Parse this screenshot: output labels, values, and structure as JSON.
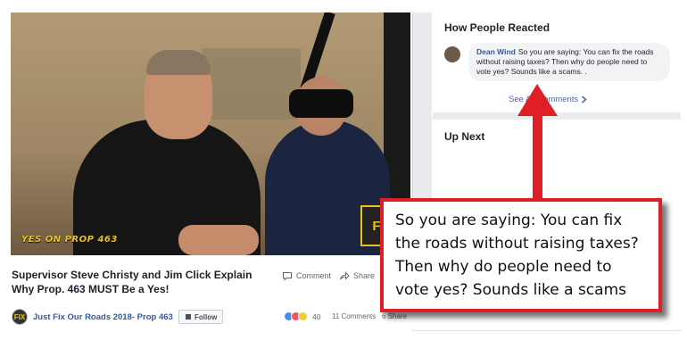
{
  "video": {
    "banner_text": "YES ON PROP 463",
    "logo_text": "FIX"
  },
  "post": {
    "title": "Supervisor Steve Christy and Jim Click Explain Why Prop. 463 MUST Be a Yes!",
    "comment_label": "Comment",
    "share_label": "Share",
    "page_name": "Just Fix Our Roads 2018- Prop 463",
    "follow_label": "Follow",
    "reaction_count": "40",
    "comments_count": "11 Comments",
    "shares_count": "6 Share"
  },
  "sidebar": {
    "reactions_heading": "How People Reacted",
    "comment": {
      "author": "Dean Wind",
      "text": "So you are saying: You can fix the roads without raising taxes? Then why do people need to vote yes? Sounds like a scams. ."
    },
    "see_all_label": "See All Comments",
    "up_next_heading": "Up Next"
  },
  "annotation": {
    "callout_text": "So you are saying: You can fix the roads without raising taxes? Then why do people need to vote yes? Sounds like a scams",
    "color": "#e01e26"
  },
  "colors": {
    "link": "#385898",
    "text": "#1d2129",
    "muted": "#606770",
    "divider": "#e9ebee"
  }
}
